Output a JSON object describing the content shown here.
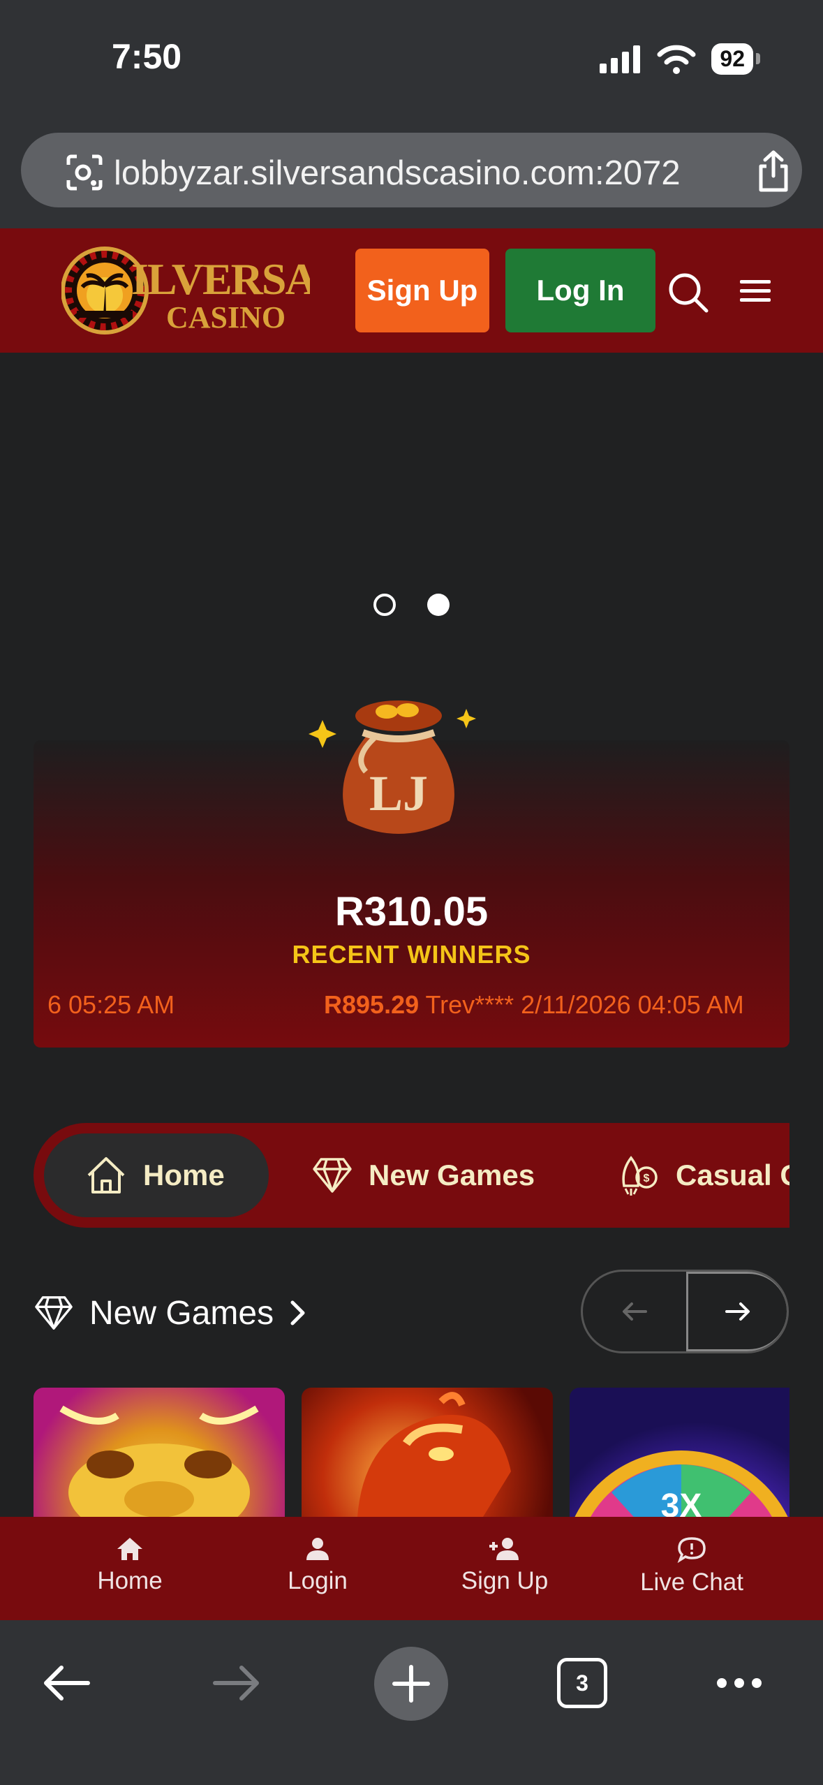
{
  "status_bar": {
    "time": "7:50",
    "battery": "92"
  },
  "browser": {
    "url": "lobbyzar.silversandscasino.com:2072",
    "tab_count": "3"
  },
  "header": {
    "logo_text": "SILVERSANDS CASINO",
    "signup_label": "Sign Up",
    "login_label": "Log In"
  },
  "winners": {
    "amount": "R310.05",
    "label": "RECENT WINNERS",
    "bag_letters": "LJ",
    "ticker_left": "6 05:25 AM",
    "ticker_amount": "R895.29",
    "ticker_rest": " Trev**** 2/11/2026 04:05 AM"
  },
  "categories": {
    "items": [
      {
        "label": "Home"
      },
      {
        "label": "New Games"
      },
      {
        "label": "Casual G"
      }
    ]
  },
  "section": {
    "title": "New Games"
  },
  "site_nav": {
    "items": [
      {
        "label": "Home"
      },
      {
        "label": "Login"
      },
      {
        "label": "Sign Up"
      },
      {
        "label": "Live Chat"
      }
    ]
  },
  "colors": {
    "header_bg": "#780b0e",
    "signup": "#f2611c",
    "login": "#1f7a35",
    "gold": "#f5c518"
  }
}
